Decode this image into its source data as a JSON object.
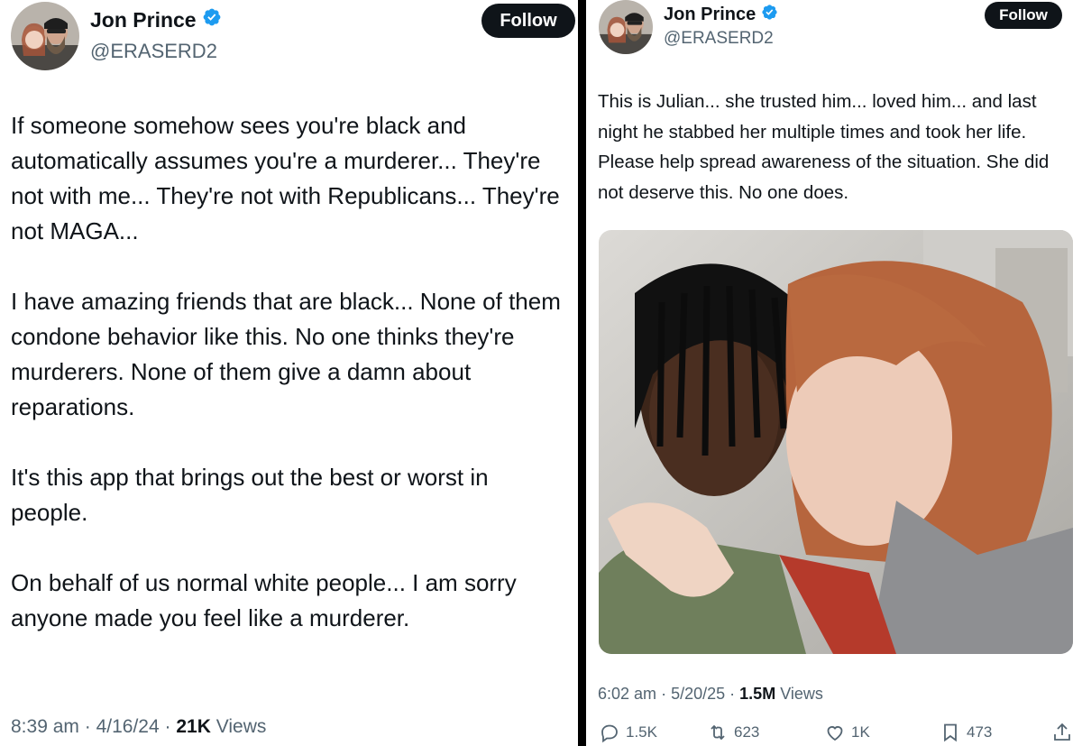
{
  "left_tweet": {
    "author": {
      "display_name": "Jon Prince",
      "handle": "@ERASERD2",
      "verified": true
    },
    "follow_label": "Follow",
    "paragraphs": [
      "If someone somehow sees you're black and automatically assumes you're a murderer... They're not with me... They're not with Republicans... They're not MAGA...",
      "I have amazing friends that are black... None of them condone behavior like this. No one thinks they're murderers. None of them give a damn about reparations.",
      "It's this app that brings out the best or worst in people.",
      "On behalf of us normal white people... I am sorry anyone made you feel like a murderer."
    ],
    "time": "8:39 am",
    "date": "4/16/24",
    "views_count": "21K",
    "views_label": "Views"
  },
  "right_tweet": {
    "author": {
      "display_name": "Jon Prince",
      "handle": "@ERASERD2",
      "verified": true
    },
    "follow_label": "Follow",
    "text": "This is Julian... she trusted him... loved him... and last night he stabbed her multiple times and took her life. Please help spread awareness of the situation. She did not deserve this. No one does.",
    "time": "6:02 am",
    "date": "5/20/25",
    "views_count": "1.5M",
    "views_label": "Views",
    "actions": {
      "replies": "1.5K",
      "reposts": "623",
      "likes": "1K",
      "bookmarks": "473"
    }
  },
  "separator": "·",
  "colors": {
    "verified": "#1d9bf0",
    "text": "#0f1419",
    "secondary": "#536471",
    "button": "#0f1419"
  }
}
